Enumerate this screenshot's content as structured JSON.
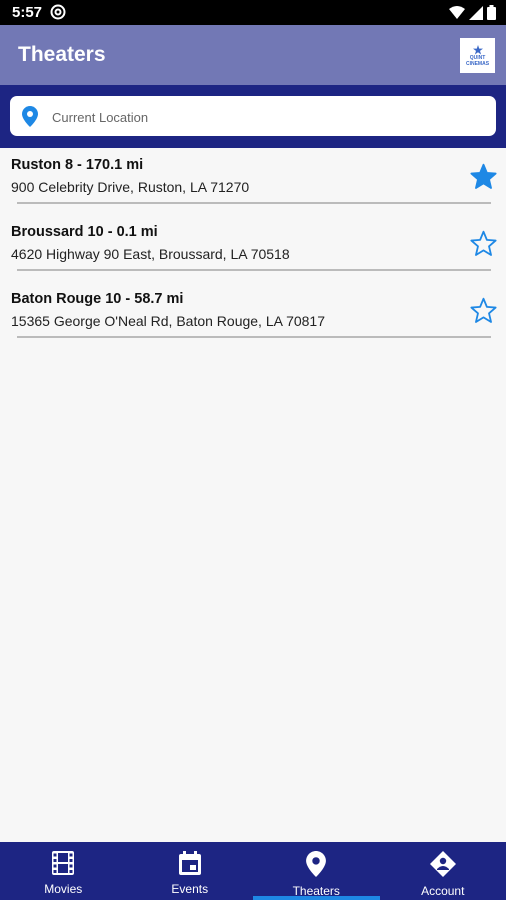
{
  "status_bar": {
    "time": "5:57",
    "at_symbol": "@"
  },
  "app_bar": {
    "title": "Theaters",
    "logo_text_1": "QUINT",
    "logo_text_2": "CINEMAS"
  },
  "search": {
    "placeholder": "Current Location",
    "icon": "location-pin-icon"
  },
  "theaters": [
    {
      "name": "Ruston 8 - 170.1 mi",
      "address": "900 Celebrity Drive, Ruston, LA 71270",
      "favorite": true
    },
    {
      "name": "Broussard 10 - 0.1 mi",
      "address": " 4620 Highway 90 East, Broussard, LA 70518",
      "favorite": false
    },
    {
      "name": "Baton Rouge 10 - 58.7 mi",
      "address": "15365 George O'Neal Rd, Baton Rouge, LA 70817",
      "favorite": false
    }
  ],
  "bottom_nav": [
    {
      "label": "Movies",
      "icon": "film-icon",
      "active": false
    },
    {
      "label": "Events",
      "icon": "calendar-icon",
      "active": false
    },
    {
      "label": "Theaters",
      "icon": "location-pin-icon",
      "active": true
    },
    {
      "label": "Account",
      "icon": "account-icon",
      "active": false
    }
  ],
  "colors": {
    "app_bar": "#7278b5",
    "primary_dark": "#1d2583",
    "accent": "#1e88e5",
    "background": "#f7f7f7"
  }
}
